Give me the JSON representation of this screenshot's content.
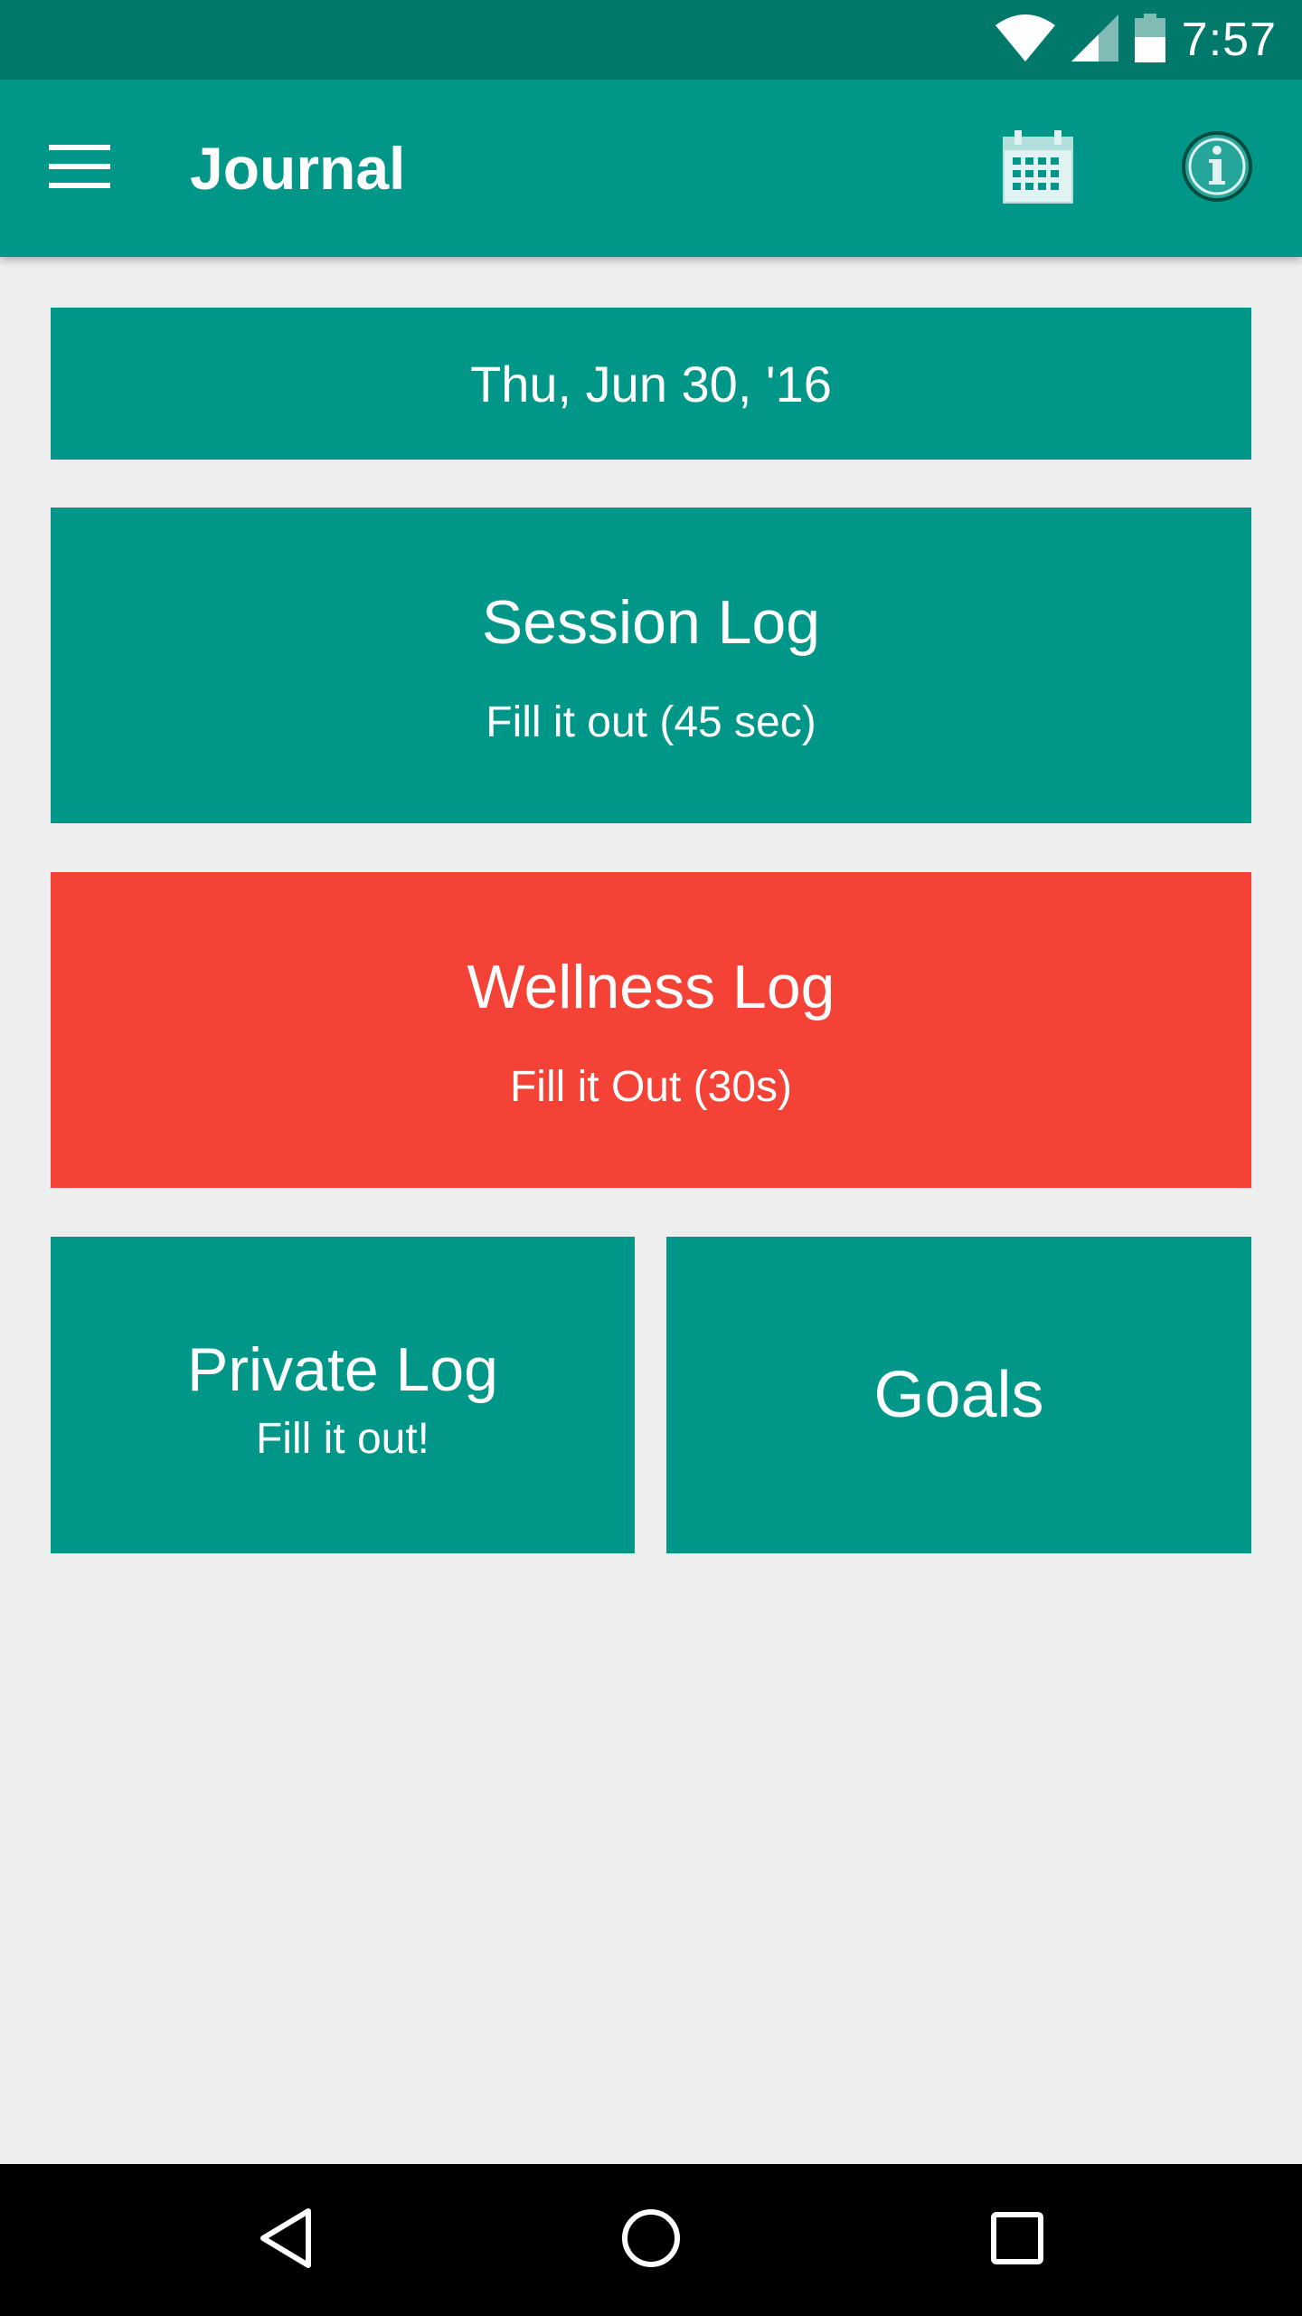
{
  "status_bar": {
    "time": "7:57",
    "icons": [
      "wifi-icon",
      "signal-icon",
      "battery-icon"
    ]
  },
  "app_bar": {
    "title": "Journal",
    "icons": [
      "menu-icon",
      "calendar-icon",
      "info-icon"
    ]
  },
  "date": {
    "label": "Thu, Jun 30, '16"
  },
  "session_log": {
    "title": "Session Log",
    "subtitle": "Fill it out (45 sec)"
  },
  "wellness_log": {
    "title": "Wellness Log",
    "subtitle": "Fill it Out (30s)"
  },
  "private_log": {
    "title": "Private Log",
    "subtitle": "Fill it out!"
  },
  "goals": {
    "title": "Goals"
  },
  "nav_bar": {
    "icons": [
      "back-icon",
      "home-icon",
      "recents-icon"
    ]
  },
  "colors": {
    "status_bar": "#00796b",
    "primary": "#009688",
    "alert": "#f44336",
    "background": "#eeeeee"
  }
}
